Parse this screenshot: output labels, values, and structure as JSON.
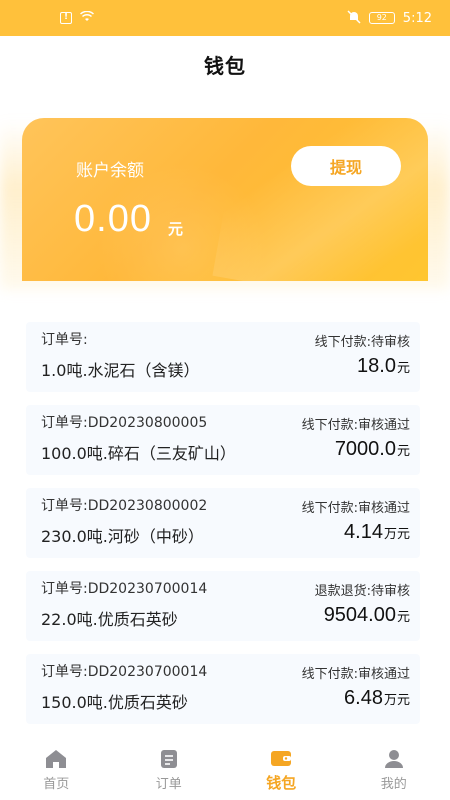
{
  "status_bar": {
    "time": "5:12",
    "battery": "92",
    "icons": [
      "alert-icon",
      "wifi-icon",
      "bell-muted-icon",
      "battery-icon"
    ]
  },
  "header": {
    "title": "钱包"
  },
  "balance": {
    "label": "账户余额",
    "amount": "0.00",
    "unit": "元",
    "withdraw_label": "提现"
  },
  "orders": [
    {
      "no_label": "订单号:",
      "status": "线下付款:待审核",
      "product": "1.0吨.水泥石（含镁）",
      "amount": "18.0",
      "unit": "元"
    },
    {
      "no_label": "订单号:DD20230800005",
      "status": "线下付款:审核通过",
      "product": "100.0吨.碎石（三友矿山）",
      "amount": "7000.0",
      "unit": "元"
    },
    {
      "no_label": "订单号:DD20230800002",
      "status": "线下付款:审核通过",
      "product": "230.0吨.河砂（中砂）",
      "amount": "4.14",
      "unit": "万元"
    },
    {
      "no_label": "订单号:DD20230700014",
      "status": "退款退货:待审核",
      "product": "22.0吨.优质石英砂",
      "amount": "9504.00",
      "unit": "元"
    },
    {
      "no_label": "订单号:DD20230700014",
      "status": "线下付款:审核通过",
      "product": "150.0吨.优质石英砂",
      "amount": "6.48",
      "unit": "万元"
    }
  ],
  "bottom_nav": [
    {
      "label": "首页",
      "icon": "home-icon",
      "active": false
    },
    {
      "label": "订单",
      "icon": "orders-icon",
      "active": false
    },
    {
      "label": "钱包",
      "icon": "wallet-icon",
      "active": true
    },
    {
      "label": "我的",
      "icon": "profile-icon",
      "active": false
    }
  ],
  "colors": {
    "accent": "#F5A623",
    "status_bar": "#FFC13B",
    "card_bg": "#F7FAFE",
    "nav_inactive": "#999999"
  }
}
